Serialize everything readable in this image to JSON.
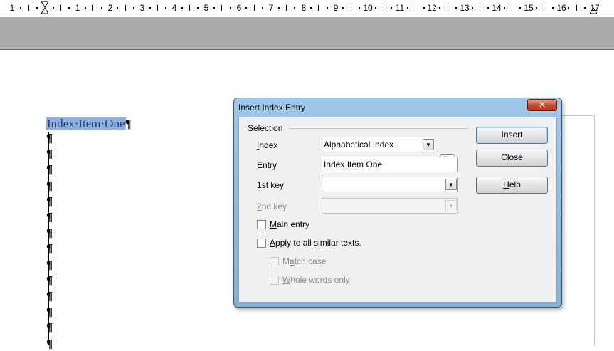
{
  "ruler": {
    "numbers": [
      "1",
      "1",
      "2",
      "3",
      "4",
      "5",
      "6",
      "7",
      "8",
      "9",
      "10",
      "11",
      "12",
      "13",
      "14",
      "15",
      "16",
      "17"
    ]
  },
  "document": {
    "selected_text": "Index·Item·One",
    "pilcrow": "¶"
  },
  "dialog": {
    "title": "Insert Index Entry",
    "close_glyph": "✕",
    "selection_group": "Selection",
    "index_label": "Index",
    "index_value": "Alphabetical Index",
    "entry_label": "Entry",
    "entry_value": "Index Item One",
    "key1_label": "1st key",
    "key1_value": "",
    "key2_label": "2nd key",
    "key2_value": "",
    "main_entry_label": "Main entry",
    "apply_all_label": "Apply to all similar texts.",
    "match_case_label": "Match case",
    "whole_words_label": "Whole words only",
    "insert_label": "Insert",
    "close_label": "Close",
    "help_label": "Help"
  },
  "colors": {
    "selection_highlight": "#8fb0dc",
    "titlebar": "#9fc7e8",
    "close_button": "#c9452a"
  }
}
